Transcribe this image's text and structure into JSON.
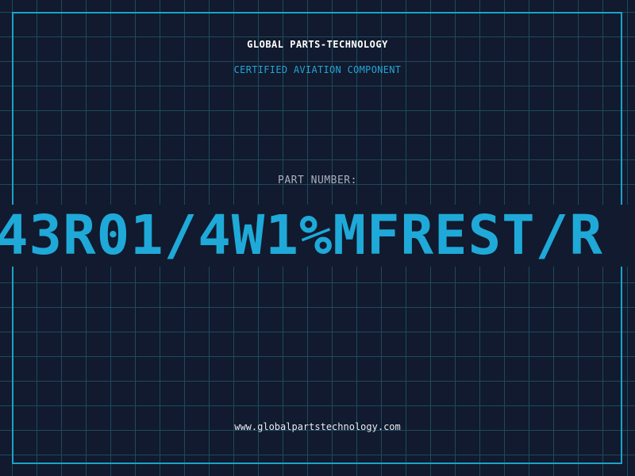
{
  "header": {
    "company_name": "GLOBAL PARTS-TECHNOLOGY",
    "subtitle": "CERTIFIED AVIATION COMPONENT"
  },
  "part": {
    "label": "PART NUMBER:",
    "number": "43R01/4W1%MFREST/R"
  },
  "footer": {
    "website": "www.globalpartstechnology.com"
  },
  "colors": {
    "background": "#111a2e",
    "grid": "#1e4a5e",
    "accent": "#1fa9d8",
    "label": "#a9b1c0"
  }
}
